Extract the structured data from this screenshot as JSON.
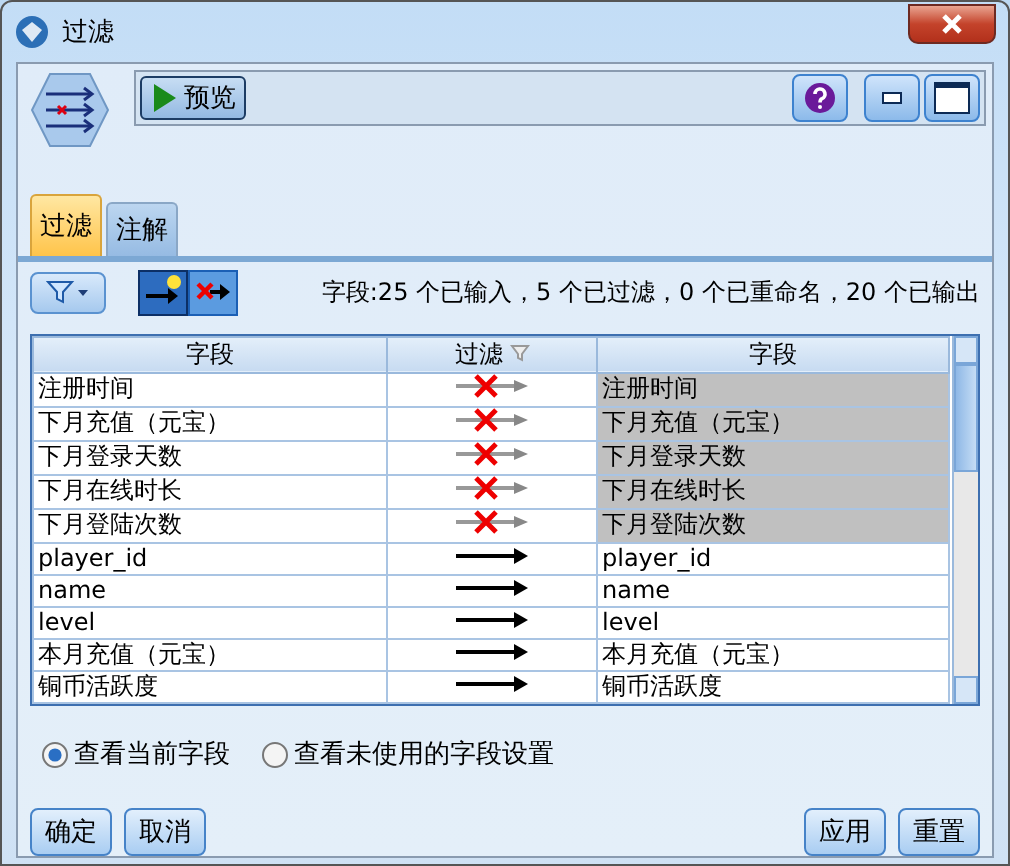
{
  "window": {
    "title": "过滤"
  },
  "toolbar": {
    "preview_button": "预览"
  },
  "tabs": [
    {
      "label": "过滤",
      "selected": true
    },
    {
      "label": "注解",
      "selected": false
    }
  ],
  "filter_toolbar": {
    "mode_buttons": [
      {
        "kind": "pass",
        "selected": true
      },
      {
        "kind": "remove",
        "selected": false
      }
    ],
    "summary": "字段:25 个已输入，5 个已过滤，0 个已重命名，20 个已输出"
  },
  "table": {
    "columns": [
      "字段",
      "过滤",
      "字段"
    ],
    "rows": [
      {
        "field": "注册时间",
        "filtered": true,
        "output": "注册时间"
      },
      {
        "field": "下月充值（元宝）",
        "filtered": true,
        "output": "下月充值（元宝）"
      },
      {
        "field": "下月登录天数",
        "filtered": true,
        "output": "下月登录天数"
      },
      {
        "field": "下月在线时长",
        "filtered": true,
        "output": "下月在线时长"
      },
      {
        "field": "下月登陆次数",
        "filtered": true,
        "output": "下月登陆次数"
      },
      {
        "field": "player_id",
        "filtered": false,
        "output": "player_id"
      },
      {
        "field": "name",
        "filtered": false,
        "output": "name"
      },
      {
        "field": "level",
        "filtered": false,
        "output": "level"
      },
      {
        "field": "本月充值（元宝）",
        "filtered": false,
        "output": "本月充值（元宝）"
      },
      {
        "field": "铜币活跃度",
        "filtered": false,
        "output": "铜币活跃度"
      }
    ]
  },
  "view_options": [
    {
      "label": "查看当前字段",
      "selected": true
    },
    {
      "label": "查看未使用的字段设置",
      "selected": false
    }
  ],
  "buttons_left": [
    "确定",
    "取消"
  ],
  "buttons_right": [
    "应用",
    "重置"
  ]
}
